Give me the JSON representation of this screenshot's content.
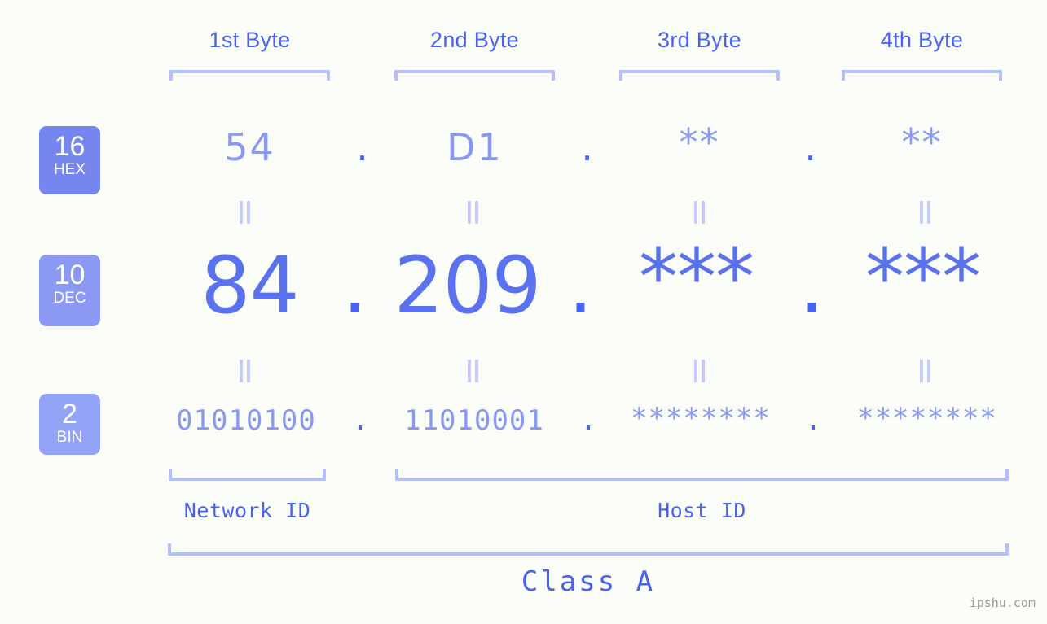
{
  "page": {
    "background_color": "#fbfdf9",
    "accent_color": "#4a62f0",
    "accent_light_color": "#b4bffb",
    "watermark": "ipshu.com"
  },
  "byte_headers": [
    {
      "label": "1st Byte"
    },
    {
      "label": "2nd Byte"
    },
    {
      "label": "3rd Byte"
    },
    {
      "label": "4th Byte"
    }
  ],
  "bases": [
    {
      "number": "16",
      "name": "HEX",
      "color": "#7586ef"
    },
    {
      "number": "10",
      "name": "DEC",
      "color": "#8b99f2"
    },
    {
      "number": "2",
      "name": "BIN",
      "color": "#93a3f5"
    }
  ],
  "rows": {
    "hex": {
      "base": "16",
      "base_name": "HEX",
      "values": [
        "54",
        "D1",
        "**",
        "**"
      ],
      "separator": "."
    },
    "dec": {
      "base": "10",
      "base_name": "DEC",
      "values": [
        "84",
        "209",
        "***",
        "***"
      ],
      "separator": "."
    },
    "bin": {
      "base": "2",
      "base_name": "BIN",
      "values": [
        "01010100",
        "11010001",
        "********",
        "********"
      ],
      "separator": "."
    }
  },
  "equals_marks": {
    "glyph": "||",
    "count_per_gap": 4
  },
  "segments": {
    "network_id": "Network ID",
    "host_id": "Host ID",
    "class": "Class A"
  }
}
